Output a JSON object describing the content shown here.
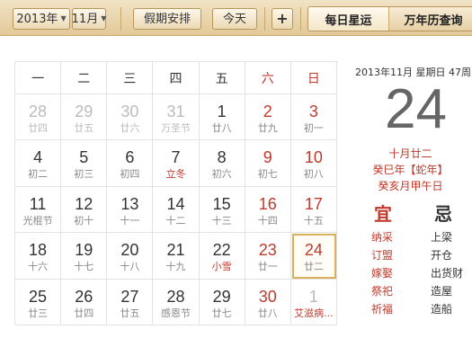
{
  "toolbar": {
    "year": "2013年",
    "month": "11月",
    "holiday_button": "假期安排",
    "today_button": "今天",
    "add_button": "+",
    "tabs": [
      "每日星运",
      "万年历查询"
    ]
  },
  "weekdays": [
    "一",
    "二",
    "三",
    "四",
    "五",
    "六",
    "日"
  ],
  "weeks": [
    [
      {
        "d": "28",
        "l": "廿四",
        "other": true
      },
      {
        "d": "29",
        "l": "廿五",
        "other": true
      },
      {
        "d": "30",
        "l": "廿六",
        "other": true
      },
      {
        "d": "31",
        "l": "万圣节",
        "other": true
      },
      {
        "d": "1",
        "l": "廿八"
      },
      {
        "d": "2",
        "l": "廿九",
        "wkend": true
      },
      {
        "d": "3",
        "l": "初一",
        "wkend": true
      }
    ],
    [
      {
        "d": "4",
        "l": "初二"
      },
      {
        "d": "5",
        "l": "初三"
      },
      {
        "d": "6",
        "l": "初四"
      },
      {
        "d": "7",
        "l": "立冬",
        "term": true
      },
      {
        "d": "8",
        "l": "初六"
      },
      {
        "d": "9",
        "l": "初七",
        "wkend": true
      },
      {
        "d": "10",
        "l": "初八",
        "wkend": true
      }
    ],
    [
      {
        "d": "11",
        "l": "光棍节"
      },
      {
        "d": "12",
        "l": "初十"
      },
      {
        "d": "13",
        "l": "十一"
      },
      {
        "d": "14",
        "l": "十二"
      },
      {
        "d": "15",
        "l": "十三"
      },
      {
        "d": "16",
        "l": "十四",
        "wkend": true
      },
      {
        "d": "17",
        "l": "十五",
        "wkend": true
      }
    ],
    [
      {
        "d": "18",
        "l": "十六"
      },
      {
        "d": "19",
        "l": "十七"
      },
      {
        "d": "20",
        "l": "十八"
      },
      {
        "d": "21",
        "l": "十九"
      },
      {
        "d": "22",
        "l": "小雪",
        "term": true
      },
      {
        "d": "23",
        "l": "廿一",
        "wkend": true
      },
      {
        "d": "24",
        "l": "廿二",
        "wkend": true,
        "today": true
      }
    ],
    [
      {
        "d": "25",
        "l": "廿三"
      },
      {
        "d": "26",
        "l": "廿四"
      },
      {
        "d": "27",
        "l": "廿五"
      },
      {
        "d": "28",
        "l": "感恩节"
      },
      {
        "d": "29",
        "l": "廿七"
      },
      {
        "d": "30",
        "l": "廿八",
        "wkend": true
      },
      {
        "d": "1",
        "l": "艾滋病...",
        "other": true,
        "festival": true
      }
    ]
  ],
  "side": {
    "date_line": "2013年11月 星期日 47周",
    "big_day": "24",
    "lunar": "十月廿二",
    "year_gz": "癸巳年【蛇年】",
    "month_day_gz": "癸亥月甲午日",
    "yi_label": "宜",
    "ji_label": "忌",
    "yi": [
      "纳采",
      "订盟",
      "嫁娶",
      "祭祀",
      "祈福"
    ],
    "ji": [
      "上梁",
      "开仓",
      "出货财",
      "造屋",
      "造船"
    ]
  },
  "colors": {
    "accent": "#c0392b",
    "toolbar": "#e2c998",
    "today_border": "#d8b25a"
  }
}
